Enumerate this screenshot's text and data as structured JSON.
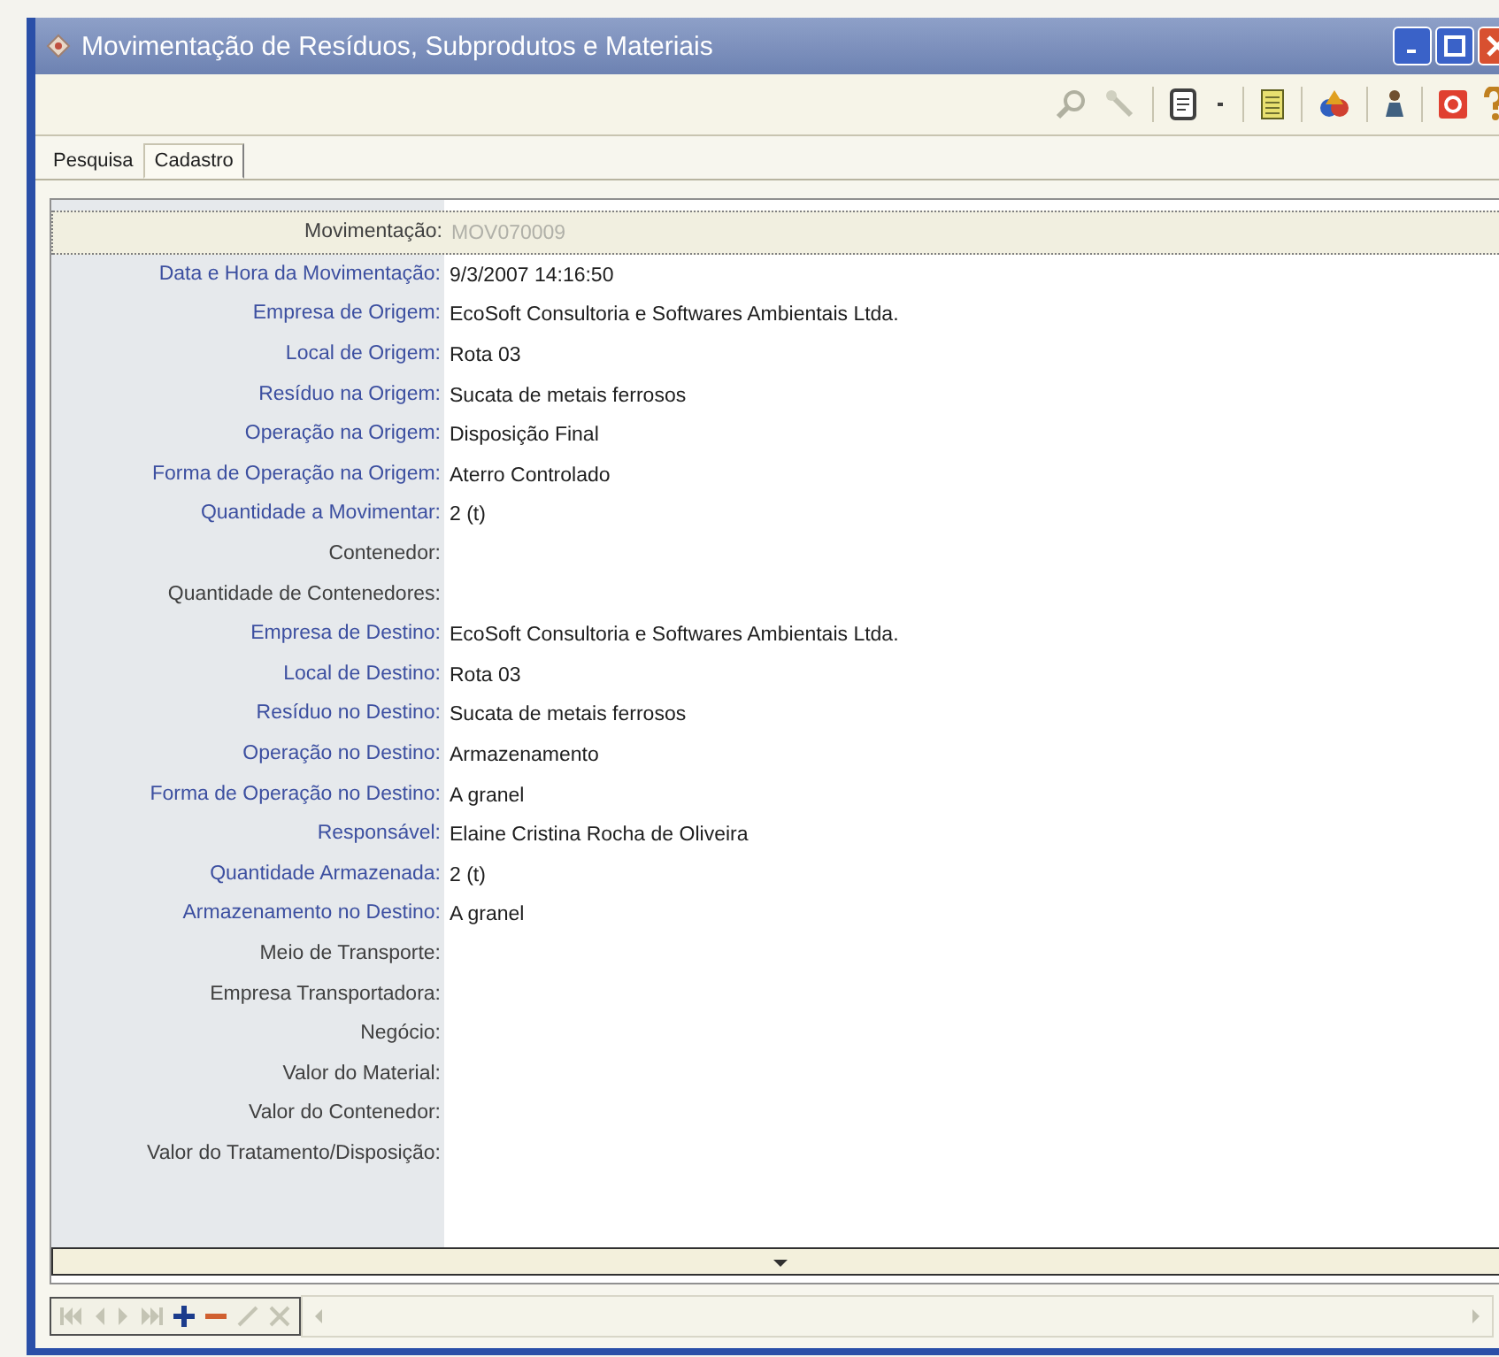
{
  "window": {
    "title": "Movimentação de Resíduos, Subprodutos e Materiais"
  },
  "tabs": [
    {
      "label": "Pesquisa",
      "selected": false
    },
    {
      "label": "Cadastro",
      "selected": true
    }
  ],
  "form": {
    "rows": [
      {
        "label": "Movimentação:",
        "value": "MOV070009",
        "required": false,
        "selected": true
      },
      {
        "label": "Data e Hora da Movimentação:",
        "value": "9/3/2007 14:16:50",
        "required": true,
        "selected": false
      },
      {
        "label": "Empresa de Origem:",
        "value": "EcoSoft Consultoria e Softwares Ambientais Ltda.",
        "required": true,
        "selected": false
      },
      {
        "label": "Local de Origem:",
        "value": "Rota 03",
        "required": true,
        "selected": false
      },
      {
        "label": "Resíduo na Origem:",
        "value": "Sucata de metais ferrosos",
        "required": true,
        "selected": false
      },
      {
        "label": "Operação na Origem:",
        "value": "Disposição Final",
        "required": true,
        "selected": false
      },
      {
        "label": "Forma de Operação na Origem:",
        "value": "Aterro Controlado",
        "required": true,
        "selected": false
      },
      {
        "label": "Quantidade a Movimentar:",
        "value": "2 (t)",
        "required": true,
        "selected": false
      },
      {
        "label": "Contenedor:",
        "required": false,
        "selected": false
      },
      {
        "label": "Quantidade de Contenedores:",
        "required": false,
        "selected": false
      },
      {
        "label": "Empresa de Destino:",
        "value": "EcoSoft Consultoria e Softwares Ambientais Ltda.",
        "required": true,
        "selected": false
      },
      {
        "label": "Local de Destino:",
        "value": "Rota 03",
        "required": true,
        "selected": false
      },
      {
        "label": "Resíduo no Destino:",
        "value": "Sucata de metais ferrosos",
        "required": true,
        "selected": false
      },
      {
        "label": "Operação no Destino:",
        "value": "Armazenamento",
        "required": true,
        "selected": false
      },
      {
        "label": "Forma de Operação no Destino:",
        "value": "A granel",
        "required": true,
        "selected": false
      },
      {
        "label": "Responsável:",
        "value": "Elaine Cristina Rocha de Oliveira",
        "required": true,
        "selected": false
      },
      {
        "label": "Quantidade Armazenada:",
        "value": "2 (t)",
        "required": true,
        "selected": false
      },
      {
        "label": "Armazenamento no Destino:",
        "value": "A granel",
        "required": true,
        "selected": false
      },
      {
        "label": "Meio de Transporte:",
        "required": false,
        "selected": false
      },
      {
        "label": "Empresa Transportadora:",
        "required": false,
        "selected": false
      },
      {
        "label": "Negócio:",
        "required": false,
        "selected": false
      },
      {
        "label": "Valor do Material:",
        "required": false,
        "selected": false
      },
      {
        "label": "Valor do Contenedor:",
        "required": false,
        "selected": false
      },
      {
        "label": "Valor do Tratamento/Disposição:",
        "required": false,
        "selected": false
      }
    ]
  },
  "navigator": [
    {
      "kind": "first",
      "disabled": true
    },
    {
      "kind": "prev",
      "disabled": true
    },
    {
      "kind": "next",
      "disabled": true
    },
    {
      "kind": "last",
      "disabled": true
    },
    {
      "kind": "add",
      "disabled": false
    },
    {
      "kind": "remove",
      "disabled": false
    },
    {
      "kind": "confirm",
      "disabled": true
    },
    {
      "kind": "cancel",
      "disabled": true
    }
  ]
}
